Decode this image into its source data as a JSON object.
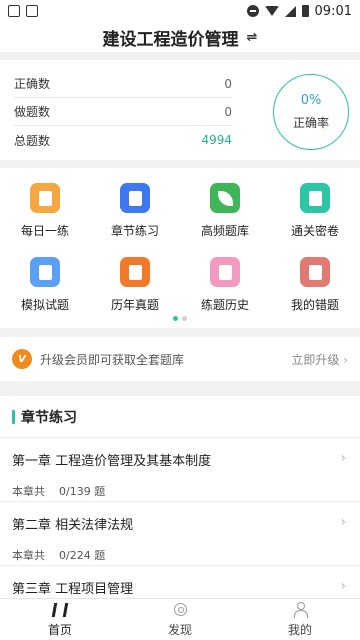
{
  "status_bar": {
    "time": "09:01"
  },
  "header": {
    "title": "建设工程造价管理",
    "switch_icon": "⇌"
  },
  "stats": {
    "rows": [
      {
        "label": "正确数",
        "value": "0"
      },
      {
        "label": "做题数",
        "value": "0"
      },
      {
        "label": "总题数",
        "value": "4994"
      }
    ],
    "rate_value": "0%",
    "rate_label": "正确率"
  },
  "menu": {
    "items": [
      {
        "label": "每日一练",
        "icon": "daily-practice-icon",
        "color": "#f5a740"
      },
      {
        "label": "章节练习",
        "icon": "chapter-practice-icon",
        "color": "#3d78f0"
      },
      {
        "label": "高频题库",
        "icon": "leaf-icon",
        "color": "#3fb55a"
      },
      {
        "label": "通关密卷",
        "icon": "secret-paper-icon",
        "color": "#2cc6a4"
      },
      {
        "label": "模拟试题",
        "icon": "mock-exam-icon",
        "color": "#5aa0f4"
      },
      {
        "label": "历年真题",
        "icon": "past-exam-icon",
        "color": "#f07a2a"
      },
      {
        "label": "练题历史",
        "icon": "calendar-icon",
        "color": "#f29ac0"
      },
      {
        "label": "我的错题",
        "icon": "wrong-questions-icon",
        "color": "#e07a72"
      }
    ],
    "page_count": 2,
    "active_page": 1
  },
  "upgrade": {
    "badge": "V",
    "text": "升级会员即可获取全套题库",
    "action": "立即升级"
  },
  "chapters": {
    "heading": "章节练习",
    "items": [
      {
        "name": "第一章 工程造价管理及其基本制度",
        "prefix": "本章共",
        "progress": "0/139 题"
      },
      {
        "name": "第二章 相关法律法规",
        "prefix": "本章共",
        "progress": "0/224 题"
      },
      {
        "name": "第三章 工程项目管理",
        "prefix": "",
        "progress": ""
      }
    ]
  },
  "tabbar": {
    "items": [
      {
        "label": "首页",
        "icon": "home-icon"
      },
      {
        "label": "发现",
        "icon": "discover-icon"
      },
      {
        "label": "我的",
        "icon": "profile-icon"
      }
    ]
  }
}
